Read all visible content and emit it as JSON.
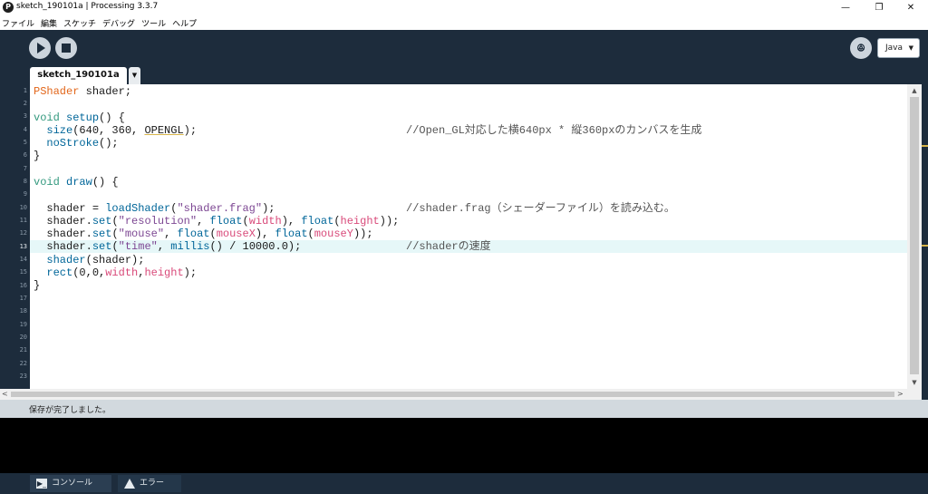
{
  "window": {
    "title": "sketch_190101a | Processing 3.3.7",
    "app_icon": "processing-logo-icon",
    "min_glyph": "—",
    "max_glyph": "❐",
    "close_glyph": "✕"
  },
  "menu": [
    "ファイル",
    "編集",
    "スケッチ",
    "デバッグ",
    "ツール",
    "ヘルプ"
  ],
  "toolbar": {
    "run_icon": "play-icon",
    "stop_icon": "stop-icon",
    "debug_icon": "butterfly-debug-icon",
    "debug_glyph": "ꔮ",
    "mode": "Java",
    "mode_chevron": "▼"
  },
  "tabs": {
    "active": "sketch_190101a",
    "menu_glyph": "▼"
  },
  "editor": {
    "current_line": 13,
    "line_numbers": [
      "1",
      "2",
      "3",
      "4",
      "5",
      "6",
      "7",
      "8",
      "9",
      "10",
      "11",
      "12",
      "13",
      "14",
      "15",
      "16",
      "17",
      "18",
      "19",
      "20",
      "21",
      "22",
      "23"
    ]
  },
  "code": {
    "l1_type": "PShader",
    "l1_rest": " shader;",
    "l3_kw": "void",
    "l3_fn": "setup",
    "l3_rest": "() {",
    "l4_fn": "size",
    "l4_args": "(640, 360, ",
    "l4_const": "OPENGL",
    "l4_end": ");",
    "l4_comment": "//Open_GL対応した横640px * 縦360pxのカンバスを生成",
    "l5_fn": "noStroke",
    "l5_end": "();",
    "l6": "}",
    "l8_kw": "void",
    "l8_fn": "draw",
    "l8_rest": "() {",
    "l10_a": "shader = ",
    "l10_fn": "loadShader",
    "l10_b": "(",
    "l10_str": "\"shader.frag\"",
    "l10_c": ");",
    "l10_comment": "//shader.frag（シェーダーファイル）を読み込む。",
    "l11_a": "shader.",
    "l11_fn": "set",
    "l11_b": "(",
    "l11_str": "\"resolution\"",
    "l11_c": ", ",
    "l11_f1": "float",
    "l11_d": "(",
    "l11_v1": "width",
    "l11_e": "), ",
    "l11_f2": "float",
    "l11_g": "(",
    "l11_v2": "height",
    "l11_h": "));",
    "l12_a": "shader.",
    "l12_fn": "set",
    "l12_b": "(",
    "l12_str": "\"mouse\"",
    "l12_c": ", ",
    "l12_f1": "float",
    "l12_d": "(",
    "l12_v1": "mouseX",
    "l12_e": "), ",
    "l12_f2": "float",
    "l12_g": "(",
    "l12_v2": "mouseY",
    "l12_h": "));",
    "l13_a": "shader.",
    "l13_fn": "set",
    "l13_b": "(",
    "l13_str": "\"time\"",
    "l13_c": ", ",
    "l13_f1": "millis",
    "l13_d": "() / 10000.0);",
    "l13_comment": "//shaderの速度",
    "l14_fn": "shader",
    "l14_rest": "(shader);",
    "l15_fn": "rect",
    "l15_a": "(0,0,",
    "l15_v1": "width",
    "l15_b": ",",
    "l15_v2": "height",
    "l15_c": ");",
    "l16": "}"
  },
  "scroll": {
    "up": "▲",
    "down": "▼",
    "left": "<",
    "right": ">"
  },
  "status": {
    "message": "保存が完了しました。"
  },
  "footer": {
    "console_label": "コンソール",
    "errors_label": "エラー",
    "console_icon": "console-icon",
    "errors_icon": "warning-icon",
    "console_glyph": "▶_",
    "warning_glyph": "!"
  },
  "colors": {
    "chrome_dark": "#1d2c3c",
    "status_bar": "#d2d9de",
    "current_line": "#e6f7f8",
    "type": "#e2661a",
    "keyword": "#33997e",
    "function": "#006699",
    "string": "#7d4793",
    "variable": "#d94a7a"
  }
}
